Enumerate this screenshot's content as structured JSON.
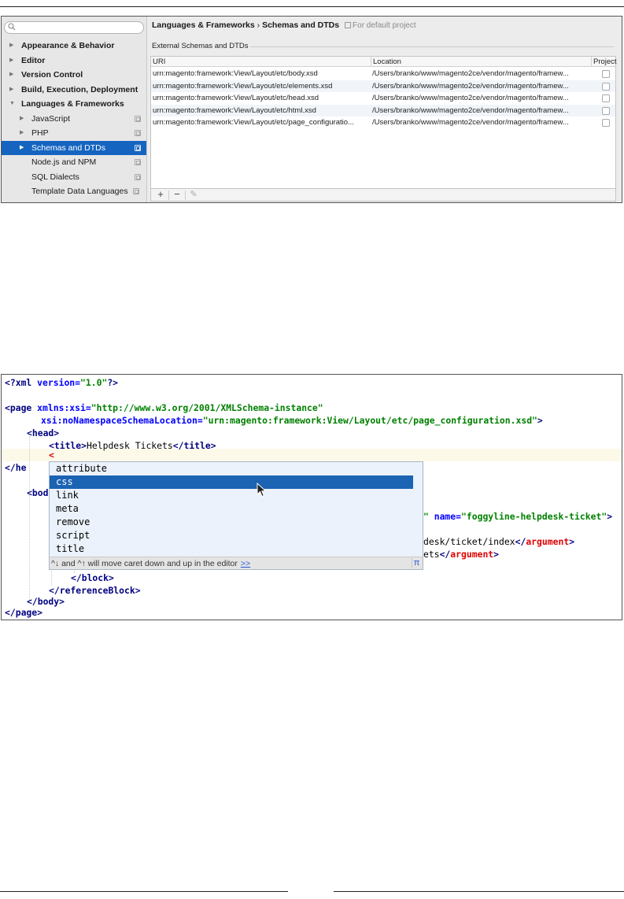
{
  "settings": {
    "sidebar": {
      "search_placeholder": "",
      "items": [
        {
          "label": "Appearance & Behavior",
          "arrow": "▶",
          "bold": true
        },
        {
          "label": "Editor",
          "arrow": "▶",
          "bold": true
        },
        {
          "label": "Version Control",
          "arrow": "▶",
          "bold": true
        },
        {
          "label": "Build, Execution, Deployment",
          "arrow": "▶",
          "bold": true
        },
        {
          "label": "Languages & Frameworks",
          "arrow": "▼",
          "bold": true
        },
        {
          "label": "JavaScript",
          "arrow": "▶",
          "bold": false
        },
        {
          "label": "PHP",
          "arrow": "▶",
          "bold": false
        },
        {
          "label": "Schemas and DTDs",
          "arrow": "▶",
          "bold": false,
          "selected": true
        },
        {
          "label": "Node.js and NPM",
          "arrow": "",
          "bold": false
        },
        {
          "label": "SQL Dialects",
          "arrow": "",
          "bold": false
        },
        {
          "label": "Template Data Languages",
          "arrow": "",
          "bold": false
        }
      ]
    },
    "breadcrumb": {
      "parent": "Languages & Frameworks",
      "separator": "›",
      "current": "Schemas and DTDs",
      "scope": "For default project"
    },
    "group_title": "External Schemas and DTDs",
    "table": {
      "columns": [
        "URI",
        "Location",
        "Project"
      ],
      "rows": [
        {
          "uri": "urn:magento:framework:View/Layout/etc/body.xsd",
          "location": "/Users/branko/www/magento2ce/vendor/magento/framew..."
        },
        {
          "uri": "urn:magento:framework:View/Layout/etc/elements.xsd",
          "location": "/Users/branko/www/magento2ce/vendor/magento/framew..."
        },
        {
          "uri": "urn:magento:framework:View/Layout/etc/head.xsd",
          "location": "/Users/branko/www/magento2ce/vendor/magento/framew..."
        },
        {
          "uri": "urn:magento:framework:View/Layout/etc/html.xsd",
          "location": "/Users/branko/www/magento2ce/vendor/magento/framew..."
        },
        {
          "uri": "urn:magento:framework:View/Layout/etc/page_configuratio...",
          "location": "/Users/branko/www/magento2ce/vendor/magento/framew..."
        }
      ]
    },
    "toolbar": {
      "add": "+",
      "remove": "−",
      "edit": "✎"
    }
  },
  "editor": {
    "lines": {
      "l1_a": "<?",
      "l1_b": "xml",
      "l1_c": " ",
      "l1_d": "version",
      "l1_e": "=",
      "l1_f": "\"1.0\"",
      "l1_g": "?>",
      "l3_a": "<",
      "l3_b": "page",
      "l3_c": " ",
      "l3_d": "xmlns:xsi",
      "l3_e": "=",
      "l3_f": "\"http://www.w3.org/2001/XMLSchema-instance\"",
      "l4_a": "xsi:noNamespaceSchemaLocation",
      "l4_b": "=",
      "l4_c": "\"urn:magento:framework:View/Layout/etc/page_configuration.xsd\"",
      "l4_d": ">",
      "l5_a": "<",
      "l5_b": "head",
      "l5_c": ">",
      "l6_a": "<",
      "l6_b": "title",
      "l6_c": ">",
      "l6_d": "Helpdesk Tickets",
      "l6_e": "</",
      "l6_f": "title",
      "l6_g": ">",
      "l7_a": "<",
      "l8_a": "</",
      "l8_b": "he",
      "l10_a": "<",
      "l10_b": "bod",
      "l11_a": "\"",
      "l11_b": " ",
      "l11_c": "name",
      "l11_d": "=",
      "l11_e": "\"foggyline-helpdesk-ticket\"",
      "l11_f": ">",
      "l13_a": "desk/ticket/index",
      "l13_b": "</",
      "l13_c": "argument",
      "l13_d": ">",
      "l14_a": "ets",
      "l14_b": "</",
      "l14_c": "argument",
      "l14_d": ">",
      "l15_a": "</",
      "l15_b": "block",
      "l15_c": ">",
      "l16_a": "</",
      "l16_b": "referenceBlock",
      "l16_c": ">",
      "l17_a": "</",
      "l17_b": "body",
      "l17_c": ">",
      "l18_a": "</",
      "l18_b": "page",
      "l18_c": ">"
    },
    "completion": {
      "items": [
        "attribute",
        "css",
        "link",
        "meta",
        "remove",
        "script",
        "title"
      ],
      "selected_index": 1,
      "footer_hint": "^↓ and ^↑ will move caret down and up in the editor",
      "footer_link": ">>",
      "pi_symbol": "π"
    }
  },
  "colors": {
    "selection_blue": "#1565c0",
    "popup_selection": "#1b63b3",
    "xml_tag": "#000080",
    "xml_attr": "#0000ff",
    "xml_value": "#008000",
    "xml_unknown_tag": "#e00000"
  }
}
